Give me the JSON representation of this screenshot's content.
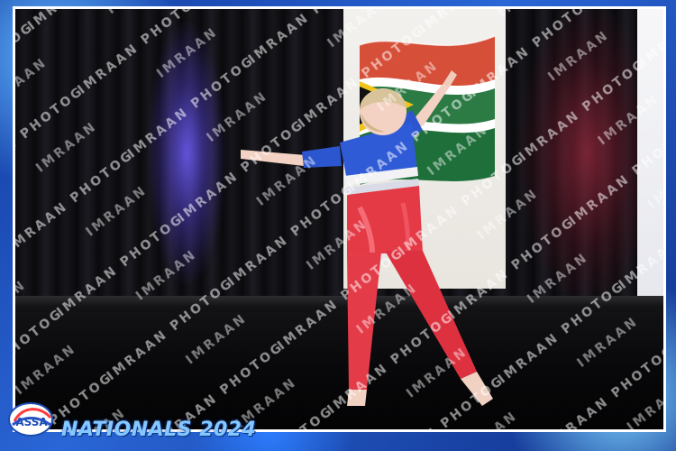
{
  "photo": {
    "watermark_text": "IMRAAN PHOTOGRAPHY",
    "subject": "young gymnast in red and blue leotard performing on stage",
    "background_elements": [
      "stage curtains",
      "South African flag banner",
      "purple stage light",
      "red stage light"
    ]
  },
  "branding": {
    "logo_text": "ASSA",
    "event_title": "NATIONALS 2024"
  },
  "colors": {
    "frame_blue": "#1f54c6",
    "title_color": "#84c8ff",
    "leotard_red": "#e33a46",
    "leotard_blue": "#2c56cf"
  },
  "icons": {
    "logo": "assa-logo-icon"
  }
}
